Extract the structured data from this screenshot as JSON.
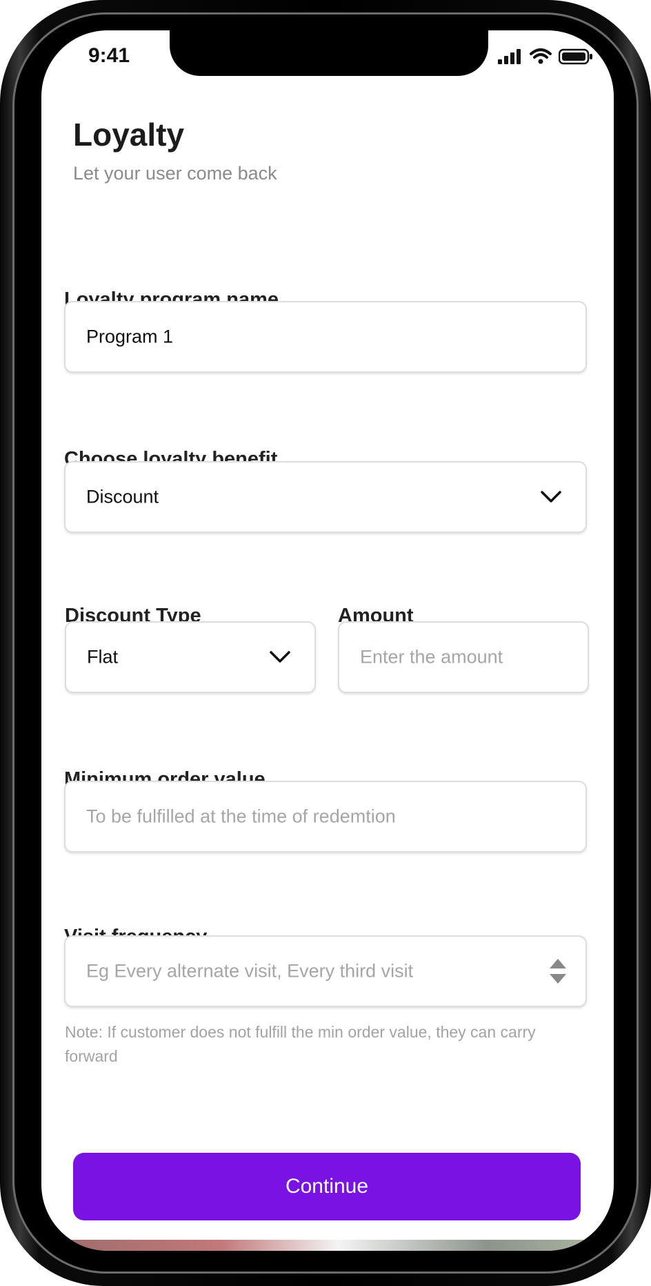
{
  "status_bar": {
    "time": "9:41"
  },
  "header": {
    "title": "Loyalty",
    "subtitle": "Let your user come back"
  },
  "form": {
    "program_name": {
      "label": "Loyalty program name",
      "value": "Program 1"
    },
    "benefit": {
      "label": "Choose loyalty benefit",
      "value": "Discount"
    },
    "discount_type": {
      "label": "Discount Type",
      "value": "Flat"
    },
    "amount": {
      "label": "Amount",
      "placeholder": "Enter the amount"
    },
    "min_order": {
      "label": "Minimum order value",
      "placeholder": "To be fulfilled at the time of redemtion"
    },
    "visit_frequency": {
      "label": "Visit frequency",
      "placeholder": "Eg Every alternate visit, Every third visit"
    },
    "note": "Note: If customer does not fulfill the min order value, they can carry forward"
  },
  "actions": {
    "continue_label": "Continue"
  },
  "icons": {
    "signal": "signal-icon",
    "wifi": "wifi-icon",
    "battery": "battery-icon",
    "dropdown": "chevron-down-icon",
    "stepper": "stepper-icon"
  },
  "colors": {
    "accent": "#7a12e4",
    "title": "#1c1c1c",
    "muted": "#8a8a8a",
    "placeholder": "#a6a6a6",
    "border": "#dddddd"
  }
}
